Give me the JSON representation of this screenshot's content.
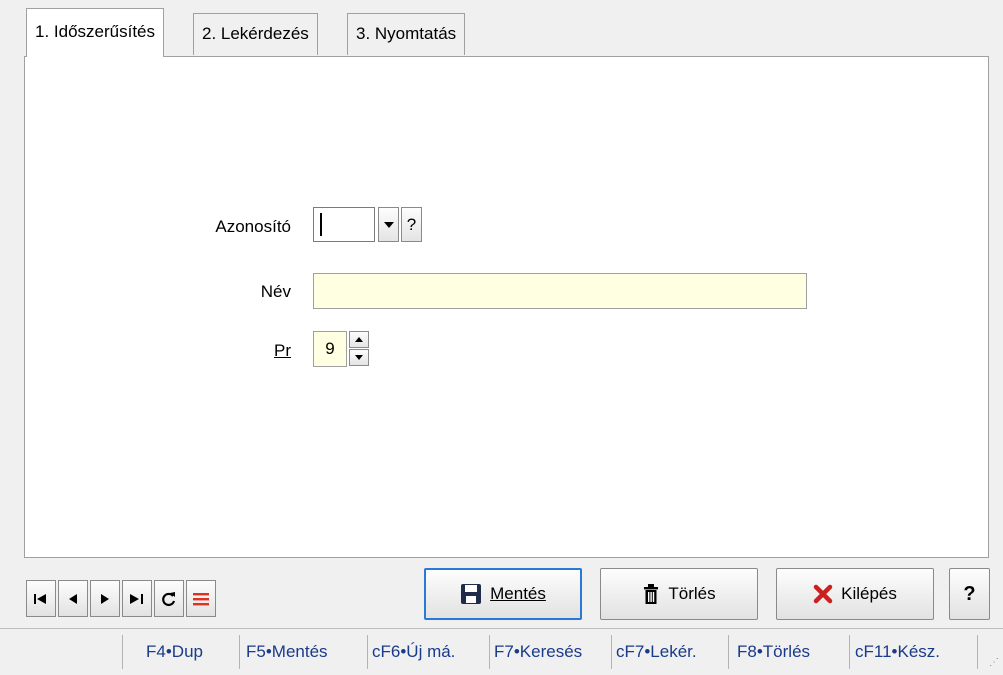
{
  "tabs": [
    {
      "label": "1. Időszerűsítés",
      "active": true
    },
    {
      "label": "2. Lekérdezés",
      "active": false
    },
    {
      "label": "3. Nyomtatás",
      "active": false
    }
  ],
  "form": {
    "id_label": "Azonosító",
    "id_value": "",
    "id_help": "?",
    "name_label": "Név",
    "name_value": "",
    "pr_label": "Pr",
    "pr_value": "9"
  },
  "navigation": {
    "icons": [
      "first-record-icon",
      "previous-record-icon",
      "next-record-icon",
      "last-record-icon",
      "refresh-icon",
      "list-icon"
    ]
  },
  "actions": {
    "save_label": "Mentés",
    "delete_label": "Törlés",
    "exit_label": "Kilépés",
    "help_label": "?"
  },
  "status_bar": {
    "items": [
      "F4•Dup",
      "F5•Mentés",
      "cF6•Új má.",
      "F7•Keresés",
      "cF7•Lekér.",
      "F8•Törlés",
      "cF11•Kész."
    ]
  },
  "colors": {
    "field_background": "#ffffe1",
    "default_button_border": "#2b78d6",
    "delete_accent": "#cc2020",
    "status_text": "#1a3a8a"
  }
}
